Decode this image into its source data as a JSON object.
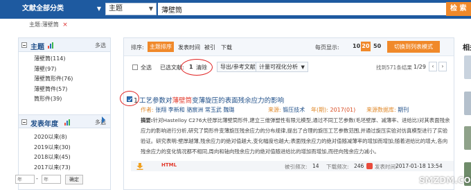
{
  "search": {
    "category": "文献全部分类",
    "field": "主题",
    "query": "薄壁筒",
    "button": "检 索"
  },
  "subject_tag": {
    "label": "主题:薄壁筒",
    "close": "×"
  },
  "sidebar": {
    "topic": {
      "title": "主题",
      "multi": "多选",
      "items": [
        "薄壁筒(114)",
        "薄壁(97)",
        "薄壁筒形件(76)",
        "薄壁筒件(57)",
        "筒形件(39)"
      ]
    },
    "year": {
      "title": "发表年度",
      "multi": "多选",
      "items": [
        "2020以来(8)",
        "2019以来(30)",
        "2018以来(45)",
        "2017以来(73)"
      ],
      "from_placeholder": "年",
      "to_placeholder": "年",
      "confirm": "确定"
    }
  },
  "sortbar": {
    "label": "排序:",
    "active": "主题排序",
    "options": [
      "发表时间",
      "被引",
      "下载"
    ],
    "per_page_label": "每页显示:",
    "per_page": [
      "10",
      "20",
      "50"
    ],
    "per_page_active": "20",
    "list_mode": "切换到列表模式"
  },
  "toolbar": {
    "select_all": "全选",
    "selected_label": "已选文献:",
    "selected_count": "1",
    "clear": "清除",
    "export": "导出/参考文献",
    "visualize": "计量可视化分析",
    "found": "找到571条结果",
    "page": "1/29"
  },
  "result": {
    "num": "1",
    "title_pre": "工艺参数对",
    "title_hl": "薄壁筒",
    "title_post": "变薄旋压的表面残余应力的影响",
    "authors_label": "作者:",
    "authors": "张翔  李新和  骆宸洲  常玉武  魏璐",
    "source_label": "来源:",
    "source": "锻压技术",
    "year_label": "年(期):",
    "year": "2017(01)",
    "db_label": "来源数据库:",
    "db": "期刊",
    "abstract_label": "摘要:",
    "abstract": "针对Hastelloy C276大径厚比薄壁筒形件,建立三维弹塑性有限元模型,通过不同工艺参数(毛坯壁厚、减薄率、进给比)对其表面残余应力的影响进行分析,研究了筒形件变薄旋压残余应力的分布规律,提出了合理的旋压工艺参数范围,并通过旋压实验对仿真模型进行了实验验证。研究表明:壁厚越薄,残余应力的绝对值越大,变化幅度也越大;表面残余应力的绝对值随减薄率的增加而增加;随着进给比的增大,各向残余应力的变化情况都不相同,周向和轴向残余应力的绝对值随进给比的增加而增加,而径向残余应力减小。",
    "html": "HTML",
    "cited_label": "被引频次:",
    "cited": "14",
    "downloads_label": "下载频次:",
    "downloads": "246",
    "date_label": "发表时间:",
    "date": "2017-01-18 13:54"
  },
  "right_panel": {
    "title": "相关"
  },
  "watermark": "SMZDM.COM",
  "colors": {
    "topbar": "#1e5aa0",
    "accent": "#f0892a",
    "highlight": "#e23a2c",
    "link": "#1e4e88",
    "annotation": "#e02020"
  },
  "icons": [
    "checkbox-icon",
    "chart-icon",
    "download-icon",
    "minus-icon",
    "arrow-right-icon"
  ]
}
